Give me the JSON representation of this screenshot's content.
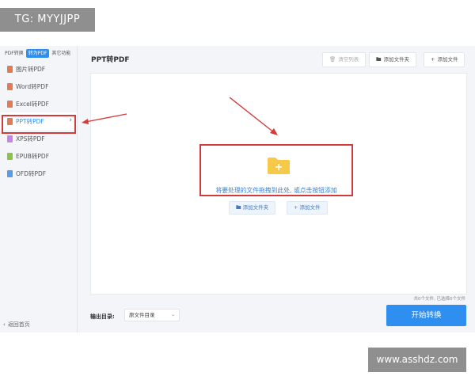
{
  "watermarks": {
    "top": "TG: MYYJJPP",
    "bottom": "www.asshdz.com"
  },
  "sidebar": {
    "tabs": [
      {
        "label": "PDF转换",
        "active": false
      },
      {
        "label": "转为PDF",
        "active": true
      },
      {
        "label": "其它功能",
        "active": false
      }
    ],
    "items": [
      {
        "label": "图片转PDF",
        "icon": "image-file-icon",
        "color": "#e07b55"
      },
      {
        "label": "Word转PDF",
        "icon": "word-file-icon",
        "color": "#e07b55"
      },
      {
        "label": "Excel转PDF",
        "icon": "excel-file-icon",
        "color": "#e07b55"
      },
      {
        "label": "PPT转PDF",
        "icon": "ppt-file-icon",
        "color": "#e07b55",
        "active": true
      },
      {
        "label": "XPS转PDF",
        "icon": "xps-file-icon",
        "color": "#c985e6"
      },
      {
        "label": "EPUB转PDF",
        "icon": "epub-file-icon",
        "color": "#8bc34a"
      },
      {
        "label": "OFD转PDF",
        "icon": "ofd-file-icon",
        "color": "#5a9be6"
      }
    ],
    "back_label": "返回首页"
  },
  "main": {
    "title": "PPT转PDF",
    "toolbar": {
      "clear": "清空列表",
      "add_folder": "添加文件夹",
      "add_file": "添加文件"
    },
    "dropzone": {
      "hint": "将要处理的文件拖拽到此处, 或点击按钮添加",
      "add_folder": "添加文件夹",
      "add_file": "添加文件"
    },
    "status": "共0个文件, 已选择0个文件",
    "output": {
      "label": "输出目录:",
      "value": "原文件目录"
    },
    "start_button": "开始转换"
  },
  "colors": {
    "accent": "#2f8ff0",
    "highlight": "#d23b3b",
    "folder": "#f7c948"
  }
}
